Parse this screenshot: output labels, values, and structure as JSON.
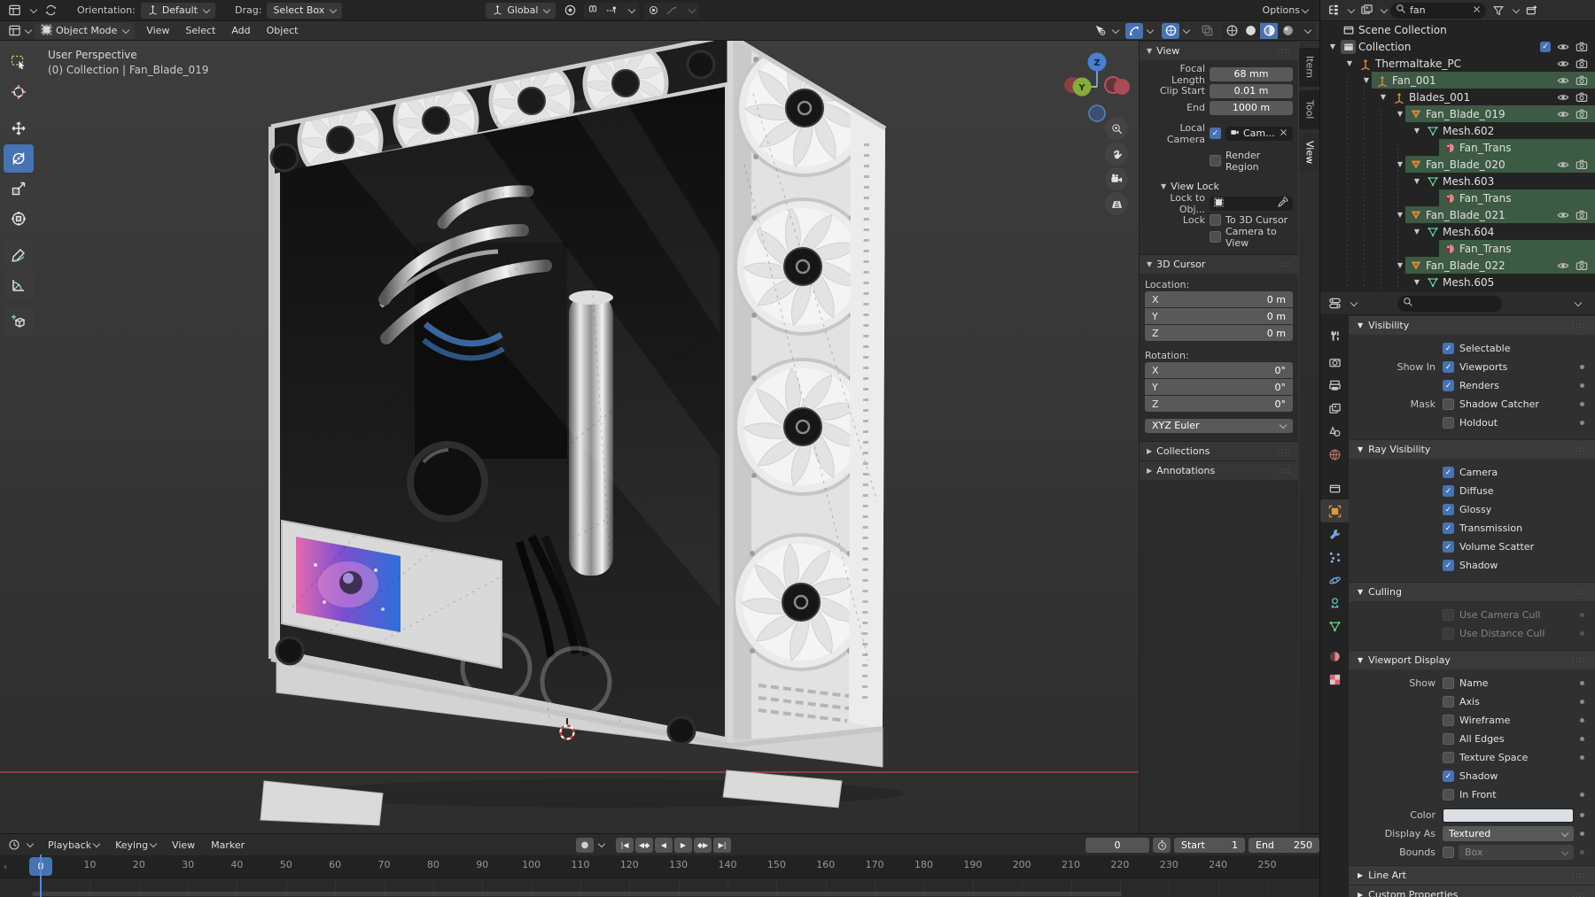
{
  "colors": {
    "accent": "#4772b3",
    "selection_green": "#3d5a44",
    "object_orange": "#e0953f"
  },
  "topbar": {
    "orientation_label": "Orientation:",
    "orientation_value": "Default",
    "drag_label": "Drag:",
    "drag_value": "Select Box",
    "transform_orientation": "Global",
    "options_label": "Options"
  },
  "viewport_header": {
    "mode": "Object Mode",
    "menus": [
      "View",
      "Select",
      "Add",
      "Object"
    ]
  },
  "toolbar": {
    "tools": [
      {
        "name": "tweak-select",
        "icon": "box-select"
      },
      {
        "name": "cursor",
        "icon": "cursor"
      },
      {
        "name": "move",
        "icon": "move"
      },
      {
        "name": "rotate",
        "icon": "rotate",
        "active": true
      },
      {
        "name": "scale",
        "icon": "scale"
      },
      {
        "name": "transform",
        "icon": "transform"
      },
      {
        "name": "annotate",
        "icon": "annotate"
      },
      {
        "name": "measure",
        "icon": "measure"
      },
      {
        "name": "add-cube",
        "icon": "add-cube"
      }
    ]
  },
  "viewport": {
    "perspective": "User Perspective",
    "context": "(0) Collection | Fan_Blade_019"
  },
  "npanel": {
    "tabs": [
      {
        "label": "Item"
      },
      {
        "label": "Tool"
      },
      {
        "label": "View",
        "active": true
      }
    ],
    "view": {
      "title": "View",
      "fields": [
        {
          "label": "Focal Length",
          "value": "68 mm"
        },
        {
          "label": "Clip Start",
          "value": "0.01 m"
        },
        {
          "label": "End",
          "value": "1000 m"
        }
      ],
      "local_camera_label": "Local Camera",
      "local_camera_value": "Cam...",
      "render_region_label": "Render Region",
      "view_lock_title": "View Lock",
      "lock_to_object_label": "Lock to Obj...",
      "lock_label": "Lock",
      "lock_items": [
        "To 3D Cursor",
        "Camera to View"
      ]
    },
    "cursor": {
      "title": "3D Cursor",
      "location_label": "Location:",
      "rotation_label": "Rotation:",
      "location": [
        {
          "axis": "X",
          "value": "0 m"
        },
        {
          "axis": "Y",
          "value": "0 m"
        },
        {
          "axis": "Z",
          "value": "0 m"
        }
      ],
      "rotation": [
        {
          "axis": "X",
          "value": "0°"
        },
        {
          "axis": "Y",
          "value": "0°"
        },
        {
          "axis": "Z",
          "value": "0°"
        }
      ],
      "euler_mode": "XYZ Euler"
    },
    "collections_title": "Collections",
    "annotations_title": "Annotations"
  },
  "outliner": {
    "search_value": "fan",
    "rows": [
      {
        "label": "Scene Collection",
        "indent": 0,
        "icon": "scene-collection",
        "arrow": "none",
        "controls": []
      },
      {
        "label": "Collection",
        "indent": 0,
        "icon": "collection",
        "iconbg": true,
        "arrow": "down",
        "checkbox": true,
        "controls": [
          "eye",
          "camera"
        ]
      },
      {
        "label": "Thermaltake_PC",
        "indent": 1,
        "icon": "empty",
        "arrow": "down",
        "controls": [
          "eye",
          "camera"
        ]
      },
      {
        "label": "Fan_001",
        "indent": 2,
        "icon": "empty",
        "arrow": "down",
        "selected": true,
        "controls": [
          "eye",
          "camera"
        ]
      },
      {
        "label": "Blades_001",
        "indent": 3,
        "icon": "empty",
        "arrow": "down",
        "controls": [
          "eye",
          "camera"
        ]
      },
      {
        "label": "Fan_Blade_019",
        "indent": 4,
        "icon": "mesh-object",
        "arrow": "down",
        "selected": true,
        "controls": [
          "eye",
          "camera"
        ]
      },
      {
        "label": "Mesh.602",
        "indent": 5,
        "icon": "mesh-data",
        "arrow": "down",
        "controls": []
      },
      {
        "label": "Fan_Trans",
        "indent": 6,
        "icon": "material",
        "arrow": "none",
        "selected": true,
        "controls": []
      },
      {
        "label": "Fan_Blade_020",
        "indent": 4,
        "icon": "mesh-object",
        "arrow": "down",
        "selected": true,
        "controls": [
          "eye",
          "camera"
        ]
      },
      {
        "label": "Mesh.603",
        "indent": 5,
        "icon": "mesh-data",
        "arrow": "down",
        "controls": []
      },
      {
        "label": "Fan_Trans",
        "indent": 6,
        "icon": "material",
        "arrow": "none",
        "selected": true,
        "controls": []
      },
      {
        "label": "Fan_Blade_021",
        "indent": 4,
        "icon": "mesh-object",
        "arrow": "down",
        "selected": true,
        "controls": [
          "eye",
          "camera"
        ]
      },
      {
        "label": "Mesh.604",
        "indent": 5,
        "icon": "mesh-data",
        "arrow": "down",
        "controls": []
      },
      {
        "label": "Fan_Trans",
        "indent": 6,
        "icon": "material",
        "arrow": "none",
        "selected": true,
        "controls": []
      },
      {
        "label": "Fan_Blade_022",
        "indent": 4,
        "icon": "mesh-object",
        "arrow": "down",
        "selected": true,
        "controls": [
          "eye",
          "camera"
        ]
      },
      {
        "label": "Mesh.605",
        "indent": 5,
        "icon": "mesh-data",
        "arrow": "down",
        "controls": []
      }
    ]
  },
  "properties": {
    "tabs": [
      {
        "name": "tool"
      },
      {
        "name": "render"
      },
      {
        "name": "output"
      },
      {
        "name": "view-layer"
      },
      {
        "name": "scene"
      },
      {
        "name": "world"
      },
      {
        "name": "collection"
      },
      {
        "name": "object",
        "active": true
      },
      {
        "name": "modifiers"
      },
      {
        "name": "particles"
      },
      {
        "name": "physics"
      },
      {
        "name": "constraints"
      },
      {
        "name": "data"
      },
      {
        "name": "material"
      },
      {
        "name": "texture"
      }
    ],
    "visibility": {
      "title": "Visibility",
      "rows": [
        {
          "prefix": "",
          "label": "Selectable",
          "checked": true,
          "dot": false
        },
        {
          "prefix": "Show In",
          "label": "Viewports",
          "checked": true,
          "dot": true
        },
        {
          "prefix": "",
          "label": "Renders",
          "checked": true,
          "dot": true
        },
        {
          "prefix": "Mask",
          "label": "Shadow Catcher",
          "checked": false,
          "dot": true
        },
        {
          "prefix": "",
          "label": "Holdout",
          "checked": false,
          "dot": true
        }
      ]
    },
    "ray_visibility": {
      "title": "Ray Visibility",
      "rows": [
        {
          "prefix": "",
          "label": "Camera",
          "checked": true,
          "dot": false
        },
        {
          "prefix": "",
          "label": "Diffuse",
          "checked": true,
          "dot": false
        },
        {
          "prefix": "",
          "label": "Glossy",
          "checked": true,
          "dot": false
        },
        {
          "prefix": "",
          "label": "Transmission",
          "checked": true,
          "dot": false
        },
        {
          "prefix": "",
          "label": "Volume Scatter",
          "checked": true,
          "dot": false
        },
        {
          "prefix": "",
          "label": "Shadow",
          "checked": true,
          "dot": false
        }
      ]
    },
    "culling": {
      "title": "Culling",
      "rows": [
        {
          "prefix": "",
          "label": "Use Camera Cull",
          "checked": false,
          "dot": true,
          "disabled": true
        },
        {
          "prefix": "",
          "label": "Use Distance Cull",
          "checked": false,
          "dot": true,
          "disabled": true
        }
      ]
    },
    "viewport_display": {
      "title": "Viewport Display",
      "rows": [
        {
          "prefix": "Show",
          "label": "Name",
          "checked": false,
          "dot": true
        },
        {
          "prefix": "",
          "label": "Axis",
          "checked": false,
          "dot": true
        },
        {
          "prefix": "",
          "label": "Wireframe",
          "checked": false,
          "dot": true
        },
        {
          "prefix": "",
          "label": "All Edges",
          "checked": false,
          "dot": true
        },
        {
          "prefix": "",
          "label": "Texture Space",
          "checked": false,
          "dot": true
        },
        {
          "prefix": "",
          "label": "Shadow",
          "checked": true,
          "dot": false
        },
        {
          "prefix": "",
          "label": "In Front",
          "checked": false,
          "dot": true
        }
      ],
      "color_label": "Color",
      "color_value": "#dcdfe3",
      "display_as_label": "Display As",
      "display_as_value": "Textured",
      "bounds_label": "Bounds",
      "bounds_value": "Box"
    },
    "line_art_title": "Line Art",
    "custom_properties_title": "Custom Properties"
  },
  "timeline": {
    "menus": [
      "Playback",
      "Keying",
      "View",
      "Marker"
    ],
    "transport": [
      {
        "name": "jump-to-start",
        "glyph": "|◀"
      },
      {
        "name": "prev-keyframe",
        "glyph": "◀◆"
      },
      {
        "name": "play-reverse",
        "glyph": "◀"
      },
      {
        "name": "play",
        "glyph": "▶"
      },
      {
        "name": "next-keyframe",
        "glyph": "◆▶"
      },
      {
        "name": "jump-to-end",
        "glyph": "▶|"
      }
    ],
    "current_frame": "0",
    "start_label": "Start",
    "start_value": "1",
    "end_label": "End",
    "end_value": "250",
    "frame_ticks": [
      0,
      10,
      20,
      30,
      40,
      50,
      60,
      70,
      80,
      90,
      100,
      110,
      120,
      130,
      140,
      150,
      160,
      170,
      180,
      190,
      200,
      210,
      220,
      230,
      240,
      250
    ]
  },
  "icons": {
    "search-icon": "magnifier",
    "close-icon": "x",
    "filter-icon": "funnel",
    "eye-icon": "visibility toggle",
    "camera-icon": "render visibility toggle",
    "magnet-icon": "snapping",
    "stopwatch-icon": "auto keyframe time",
    "clock-icon": "timeline editor"
  }
}
